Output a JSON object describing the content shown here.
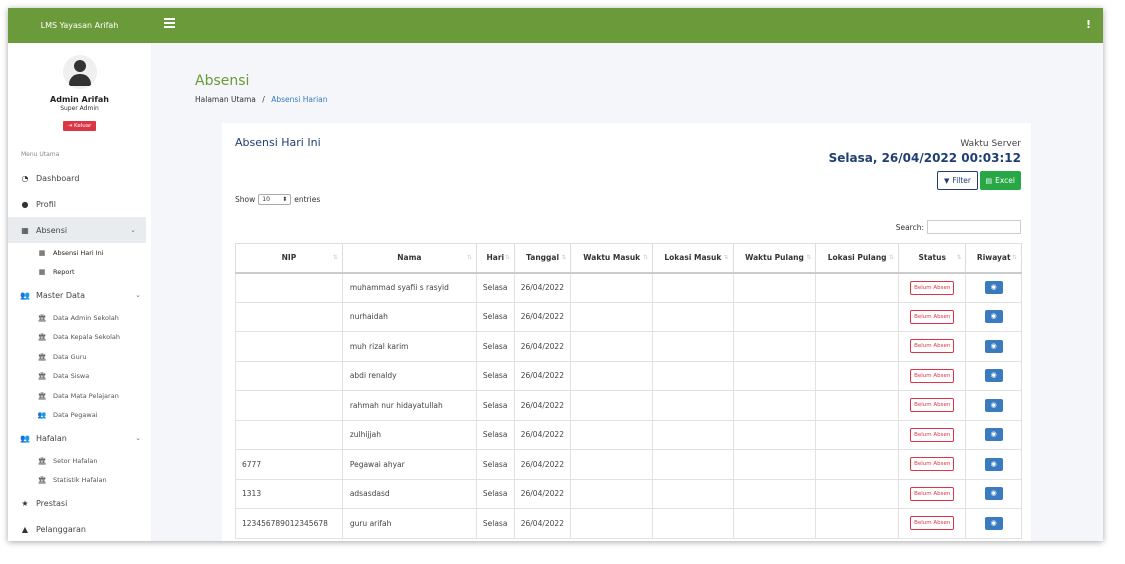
{
  "brand": "LMS Yayasan Arifah",
  "user": {
    "name": "Admin Arifah",
    "role": "Super Admin",
    "logout_label": "Keluar"
  },
  "menu": {
    "header": "Menu Utama",
    "dashboard": "Dashboard",
    "profil": "Profil",
    "absensi": {
      "label": "Absensi",
      "items": [
        "Absensi Hari Ini",
        "Report"
      ]
    },
    "master_data": {
      "label": "Master Data",
      "items": [
        "Data Admin Sekolah",
        "Data Kepala Sekolah",
        "Data Guru",
        "Data Siswa",
        "Data Mata Pelajaran",
        "Data Pegawai"
      ]
    },
    "hafalan": {
      "label": "Hafalan",
      "items": [
        "Setor Hafalan",
        "Statistik Hafalan"
      ]
    },
    "prestasi": "Prestasi",
    "pelanggaran": "Pelanggaran"
  },
  "page": {
    "title": "Absensi",
    "breadcrumb": {
      "home": "Halaman Utama",
      "separator": "/",
      "current": "Absensi Harian"
    }
  },
  "card": {
    "title": "Absensi Hari Ini",
    "server_label": "Waktu Server",
    "server_time": "Selasa, 26/04/2022 00:03:12",
    "filter_label": "Filter",
    "excel_label": "Excel",
    "show_label": "Show",
    "entries_value": "10",
    "entries_label": "entries",
    "search_label": "Search:"
  },
  "table": {
    "columns": [
      "NIP",
      "Nama",
      "Hari",
      "Tanggal",
      "Waktu Masuk",
      "Lokasi Masuk",
      "Waktu Pulang",
      "Lokasi Pulang",
      "Status",
      "Riwayat"
    ],
    "status_label": "Belum Absen",
    "rows": [
      {
        "nip": "",
        "nama": "muhammad syafii s rasyid",
        "hari": "Selasa",
        "tanggal": "26/04/2022"
      },
      {
        "nip": "",
        "nama": "nurhaidah",
        "hari": "Selasa",
        "tanggal": "26/04/2022"
      },
      {
        "nip": "",
        "nama": "muh rizal karim",
        "hari": "Selasa",
        "tanggal": "26/04/2022"
      },
      {
        "nip": "",
        "nama": "abdi renaldy",
        "hari": "Selasa",
        "tanggal": "26/04/2022"
      },
      {
        "nip": "",
        "nama": "rahmah nur hidayatullah",
        "hari": "Selasa",
        "tanggal": "26/04/2022"
      },
      {
        "nip": "",
        "nama": "zulhijjah",
        "hari": "Selasa",
        "tanggal": "26/04/2022"
      },
      {
        "nip": "6777",
        "nama": "Pegawai ahyar",
        "hari": "Selasa",
        "tanggal": "26/04/2022"
      },
      {
        "nip": "1313",
        "nama": "adsasdasd",
        "hari": "Selasa",
        "tanggal": "26/04/2022"
      },
      {
        "nip": "123456789012345678",
        "nama": "guru arifah",
        "hari": "Selasa",
        "tanggal": "26/04/2022"
      }
    ]
  },
  "colors": {
    "primary_green": "#6a9a3a",
    "navy": "#1f3f73",
    "danger": "#dc3545",
    "success": "#28a745",
    "info": "#3a7bbf"
  }
}
